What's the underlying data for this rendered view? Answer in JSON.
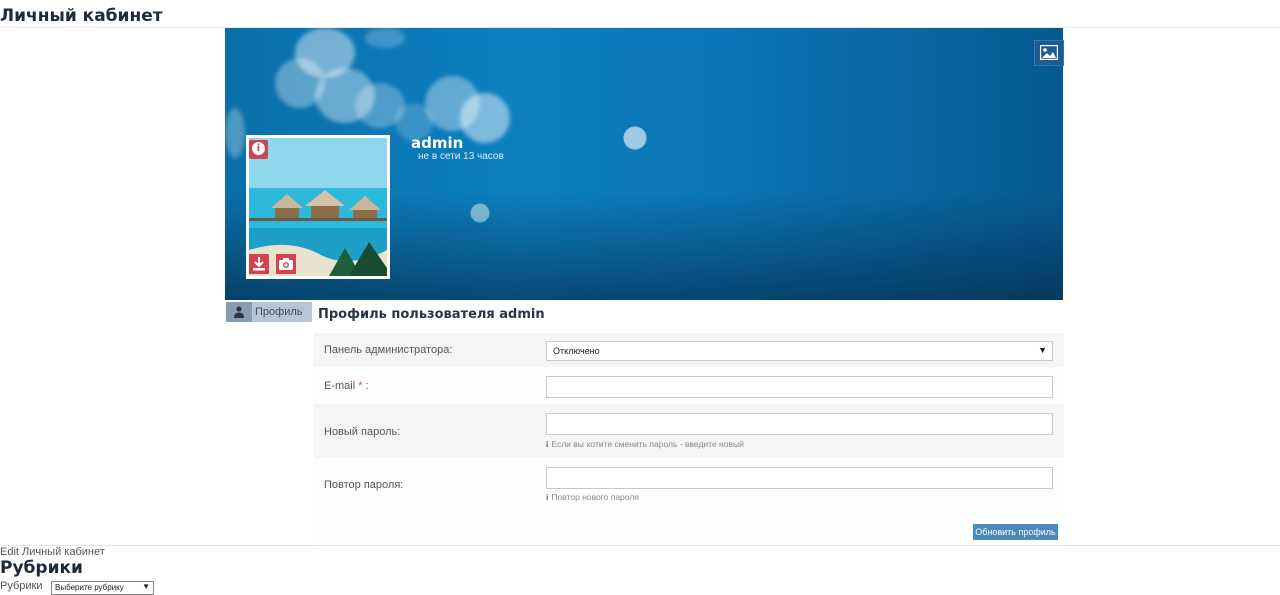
{
  "page": {
    "heading": "Личный кабинет"
  },
  "cover": {
    "change_cover_icon": "image-icon"
  },
  "user": {
    "name": "admin",
    "status": "не в сети 13 часов"
  },
  "avatar": {
    "info_icon": "info-icon",
    "upload_icon": "download-icon",
    "camera_icon": "camera-icon"
  },
  "tabs": [
    {
      "label": "Профиль",
      "icon": "user-icon"
    }
  ],
  "form": {
    "title": "Профиль пользователя admin",
    "admin_panel": {
      "label": "Панель администратора:",
      "value": "Отключено"
    },
    "email": {
      "label": "E-mail",
      "required_mark": "*",
      "suffix": ":",
      "value": ""
    },
    "new_password": {
      "label": "Новый пароль:",
      "hint": "Если вы хотите сменить пароль - введите новый"
    },
    "repeat_password": {
      "label": "Повтор пароля:",
      "hint": "Повтор нового пароля"
    },
    "hint_icon": "i",
    "submit_label": "Обновить профиль"
  },
  "footer": {
    "edit_link": "Edit Личный кабинет",
    "rubrics_heading": "Рубрики",
    "rubrics_label": "Рубрики",
    "rubrics_select": "Выберите рубрику",
    "select_arrow": "▼"
  }
}
